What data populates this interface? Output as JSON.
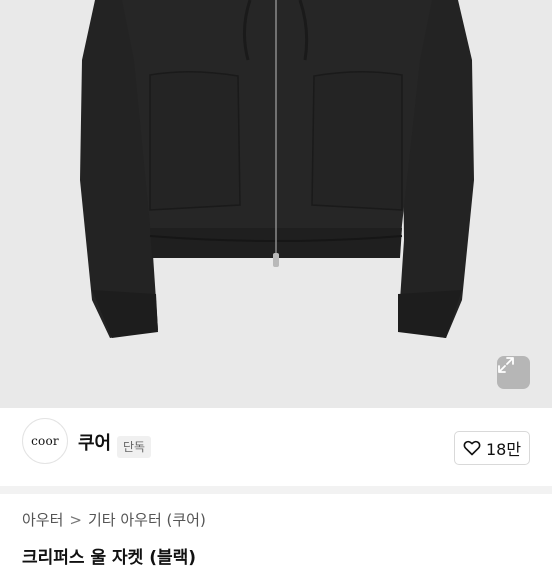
{
  "product_image": {
    "description_icon": "jacket-photo",
    "expand_icon": "expand-icon"
  },
  "seller": {
    "logo_text": "coor",
    "name": "쿠어",
    "badge": "단독",
    "like_count": "18만"
  },
  "breadcrumb": {
    "items": [
      "아우터",
      "기타 아우터 (쿠어)"
    ],
    "separator": ">"
  },
  "product_title_partial": "크리퍼스 울 자켓 (블랙)"
}
